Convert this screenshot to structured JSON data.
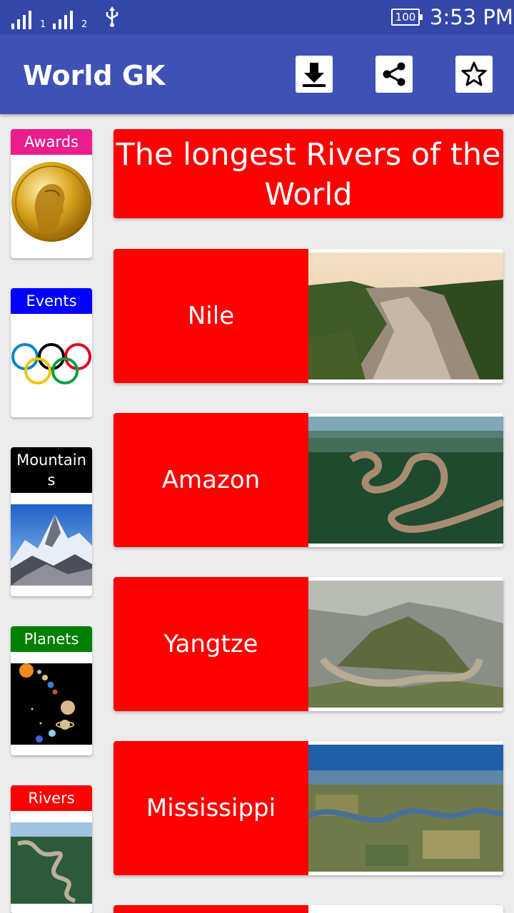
{
  "status_bar": {
    "sim1": "1",
    "sim2": "2",
    "battery": "100",
    "time": "3:53 PM",
    "icons": [
      "signal-icon",
      "usb-icon",
      "battery-icon"
    ]
  },
  "app_bar": {
    "title": "World GK",
    "actions": [
      "download-icon",
      "share-icon",
      "star-icon"
    ]
  },
  "sidebar": {
    "items": [
      {
        "label": "Awards",
        "color": "#e91e8c",
        "image": "nobel-medal"
      },
      {
        "label": "Events",
        "color": "#0000ff",
        "image": "olympic-rings"
      },
      {
        "label": "Mountain\ns",
        "color": "#000000",
        "image": "mountain-peak"
      },
      {
        "label": "Planets",
        "color": "#008000",
        "image": "solar-system"
      },
      {
        "label": "Rivers",
        "color": "#ff0000",
        "image": "river-aerial"
      }
    ]
  },
  "main": {
    "heading": "The longest Rivers of the World",
    "rivers": [
      {
        "name": "Nile"
      },
      {
        "name": "Amazon"
      },
      {
        "name": "Yangtze"
      },
      {
        "name": "Mississippi"
      }
    ]
  },
  "colors": {
    "status_bar": "#3446a8",
    "app_bar": "#3f51b5",
    "accent_red": "#ff0000",
    "background": "#ececec"
  }
}
